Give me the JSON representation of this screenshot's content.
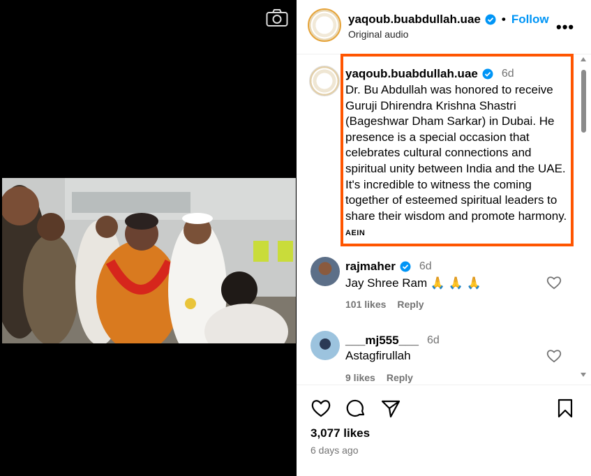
{
  "post": {
    "username": "yaqoub.buabdullah.uae",
    "follow_label": "Follow",
    "separator": "•",
    "subtitle": "Original audio",
    "more_label": "•••"
  },
  "caption": {
    "username": "yaqoub.buabdullah.uae",
    "time": "6d",
    "text": "Dr. Bu Abdullah was honored to receive Guruji Dhirendra Krishna Shastri (Bageshwar Dham Sarkar) in Dubai. He presence is a special occasion that celebrates cultural connections and spiritual unity between India and the UAE. It's incredible to witness the coming together of esteemed spiritual leaders to share their wisdom and promote harmony.",
    "tag": "AEIN"
  },
  "comments": [
    {
      "username": "rajmaher",
      "verified": true,
      "time": "6d",
      "text": "Jay Shree Ram 🙏 🙏 🙏",
      "likes": "101 likes",
      "reply_label": "Reply"
    },
    {
      "username": "___mj555___",
      "verified": false,
      "time": "6d",
      "text": "Astagfirullah",
      "likes": "9 likes",
      "reply_label": "Reply"
    }
  ],
  "footer": {
    "likes": "3,077 likes",
    "time_ago": "6 days ago"
  },
  "icons": {
    "camera": "camera-icon",
    "verified": "verified-badge-icon",
    "heart": "heart-icon",
    "comment": "comment-icon",
    "share": "share-icon",
    "save": "bookmark-icon"
  },
  "colors": {
    "accent": "#0095f6",
    "highlight_border": "#ff5500",
    "muted": "#737373"
  }
}
